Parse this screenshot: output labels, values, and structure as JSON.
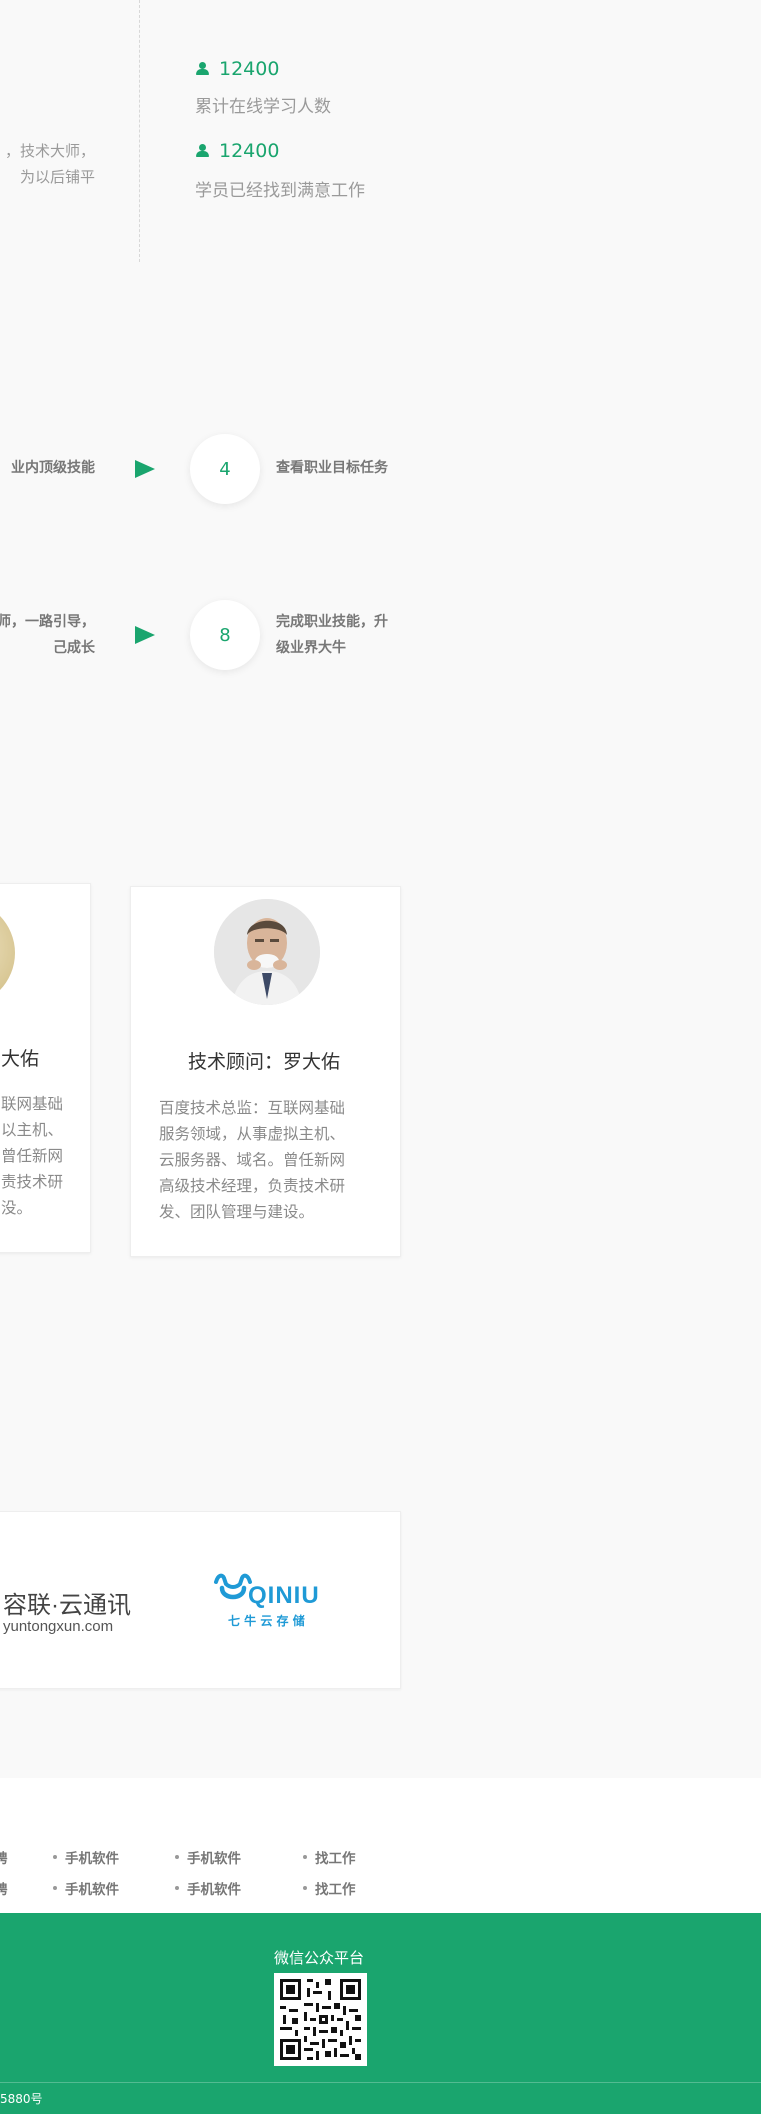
{
  "intro": {
    "line1": "，技术大师，",
    "line2": "为以后铺平"
  },
  "stats": [
    {
      "icon": "user-icon",
      "number": "12400",
      "label": "累计在线学习人数"
    },
    {
      "icon": "user-icon",
      "number": "12400",
      "label": "学员已经找到满意工作"
    }
  ],
  "steps": [
    {
      "left_lines": [
        "业内顶级技能"
      ],
      "number": "4",
      "right_lines": [
        "查看职业目标任务"
      ]
    },
    {
      "left_lines": [
        "师，一路引导，",
        "己成长"
      ],
      "number": "8",
      "right_lines": [
        "完成职业技能，升",
        "级业界大牛"
      ]
    }
  ],
  "teachers": {
    "partial": {
      "title": "大佑",
      "desc": [
        "联网基础",
        "以主机、",
        "曾任新网",
        "责技术研",
        "没。"
      ]
    },
    "full": {
      "title": "技术顾问：罗大佑",
      "desc": [
        "百度技术总监：互联网基础",
        "服务领域，从事虚拟主机、",
        "云服务器、域名。曾任新网",
        "高级技术经理，负责技术研",
        "发、团队管理与建设。"
      ]
    }
  },
  "partners": {
    "ronglian": {
      "cn": "容联·云通讯",
      "en": "yuntongxun.com"
    },
    "qiniu": {
      "en": "QINIU",
      "cn": "七 牛 云 存 储"
    }
  },
  "footer_links": {
    "row1": [
      "聘",
      "手机软件",
      "手机软件",
      "找工作"
    ],
    "row2": [
      "聘",
      "手机软件",
      "手机软件",
      "找工作"
    ]
  },
  "footer": {
    "wechat_label": "微信公众平台",
    "icp": "5880号"
  },
  "colors": {
    "accent": "#1aa56e",
    "page_bg": "#f9f9f9"
  }
}
